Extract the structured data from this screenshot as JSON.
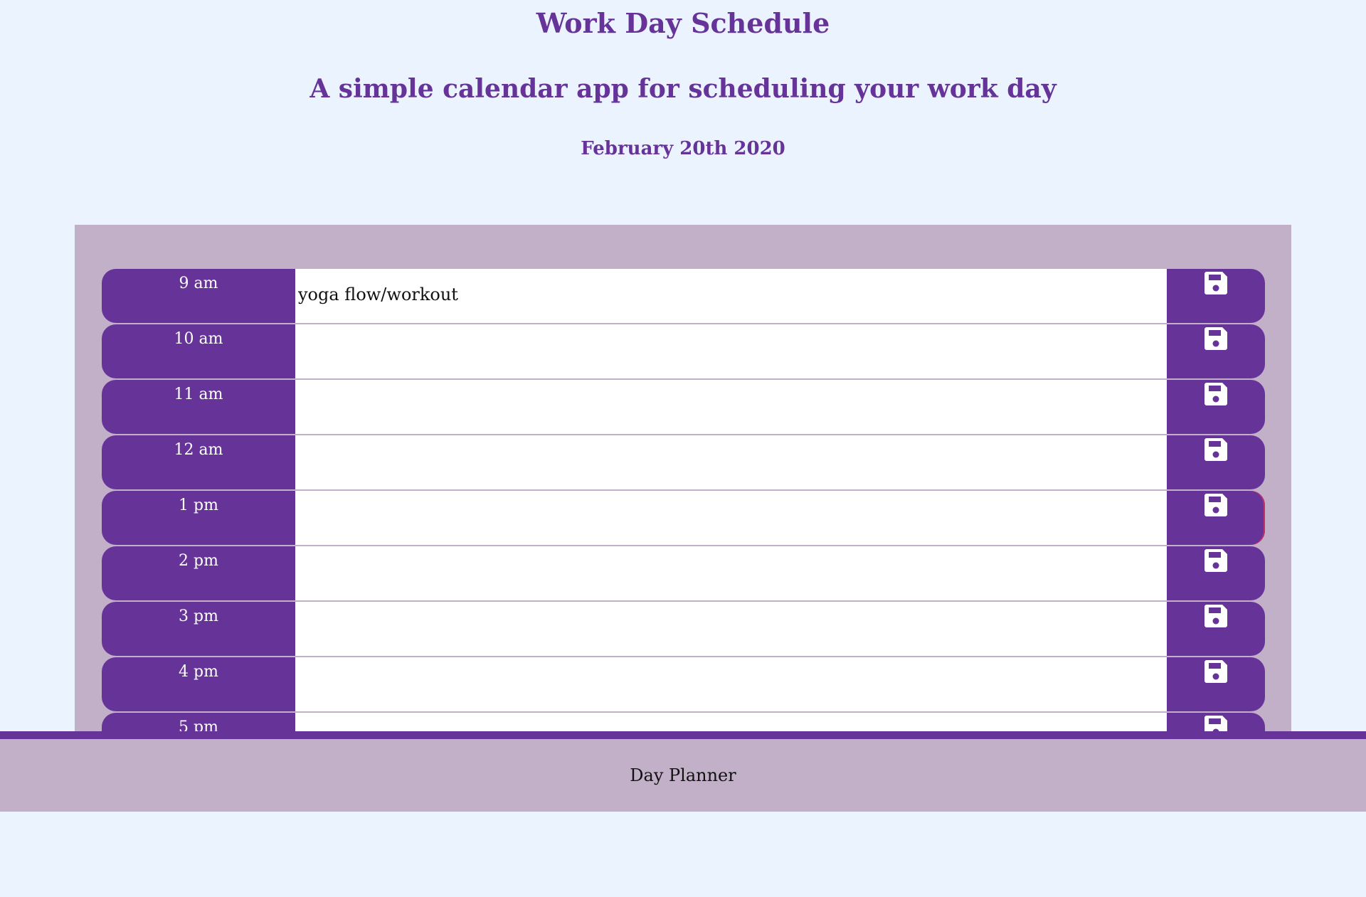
{
  "header": {
    "title": "Work Day Schedule",
    "subtitle": "A simple calendar app for scheduling your work day",
    "date": "February 20th 2020"
  },
  "schedule": {
    "rows": [
      {
        "hour": "9 am",
        "text": "yoga flow/workout",
        "save_icon": "floppy-disk-icon"
      },
      {
        "hour": "10 am",
        "text": "",
        "save_icon": "floppy-disk-icon"
      },
      {
        "hour": "11 am",
        "text": "",
        "save_icon": "floppy-disk-icon"
      },
      {
        "hour": "12 am",
        "text": "",
        "save_icon": "floppy-disk-icon"
      },
      {
        "hour": "1 pm",
        "text": "",
        "save_icon": "floppy-disk-icon"
      },
      {
        "hour": "2 pm",
        "text": "",
        "save_icon": "floppy-disk-icon"
      },
      {
        "hour": "3 pm",
        "text": "",
        "save_icon": "floppy-disk-icon"
      },
      {
        "hour": "4 pm",
        "text": "",
        "save_icon": "floppy-disk-icon"
      },
      {
        "hour": "5 pm",
        "text": "",
        "save_icon": "floppy-disk-icon"
      }
    ]
  },
  "footer": {
    "text": "Day Planner"
  },
  "colors": {
    "background": "#ebf3ff",
    "accent": "#663399",
    "panel": "#c2b0c9",
    "textarea": "#ffffff"
  }
}
